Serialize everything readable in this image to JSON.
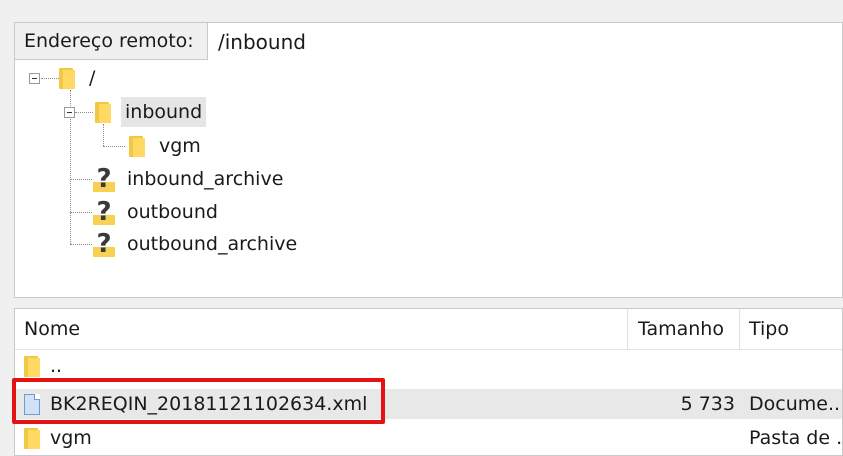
{
  "remote_address": {
    "label": "Endereço remoto:",
    "value": "/inbound"
  },
  "tree": {
    "nodes": [
      {
        "label": "/",
        "icon": "folder-icon"
      },
      {
        "label": "inbound",
        "icon": "folder-icon",
        "selected": true
      },
      {
        "label": "vgm",
        "icon": "folder-icon"
      },
      {
        "label": "inbound_archive",
        "icon": "unknown-folder-icon"
      },
      {
        "label": "outbound",
        "icon": "unknown-folder-icon"
      },
      {
        "label": "outbound_archive",
        "icon": "unknown-folder-icon"
      }
    ]
  },
  "file_list": {
    "columns": {
      "name": "Nome",
      "size": "Tamanho",
      "type": "Tipo"
    },
    "rows": [
      {
        "name": "..",
        "size": "",
        "type": "",
        "icon": "folder-icon"
      },
      {
        "name": "BK2REQIN_20181121102634.xml",
        "size": "5 733",
        "type": "Docume...",
        "icon": "file-icon",
        "highlighted": true
      },
      {
        "name": "vgm",
        "size": "",
        "type": "Pasta de ...",
        "icon": "folder-icon"
      }
    ]
  },
  "annotation": {
    "color": "#e41313"
  }
}
